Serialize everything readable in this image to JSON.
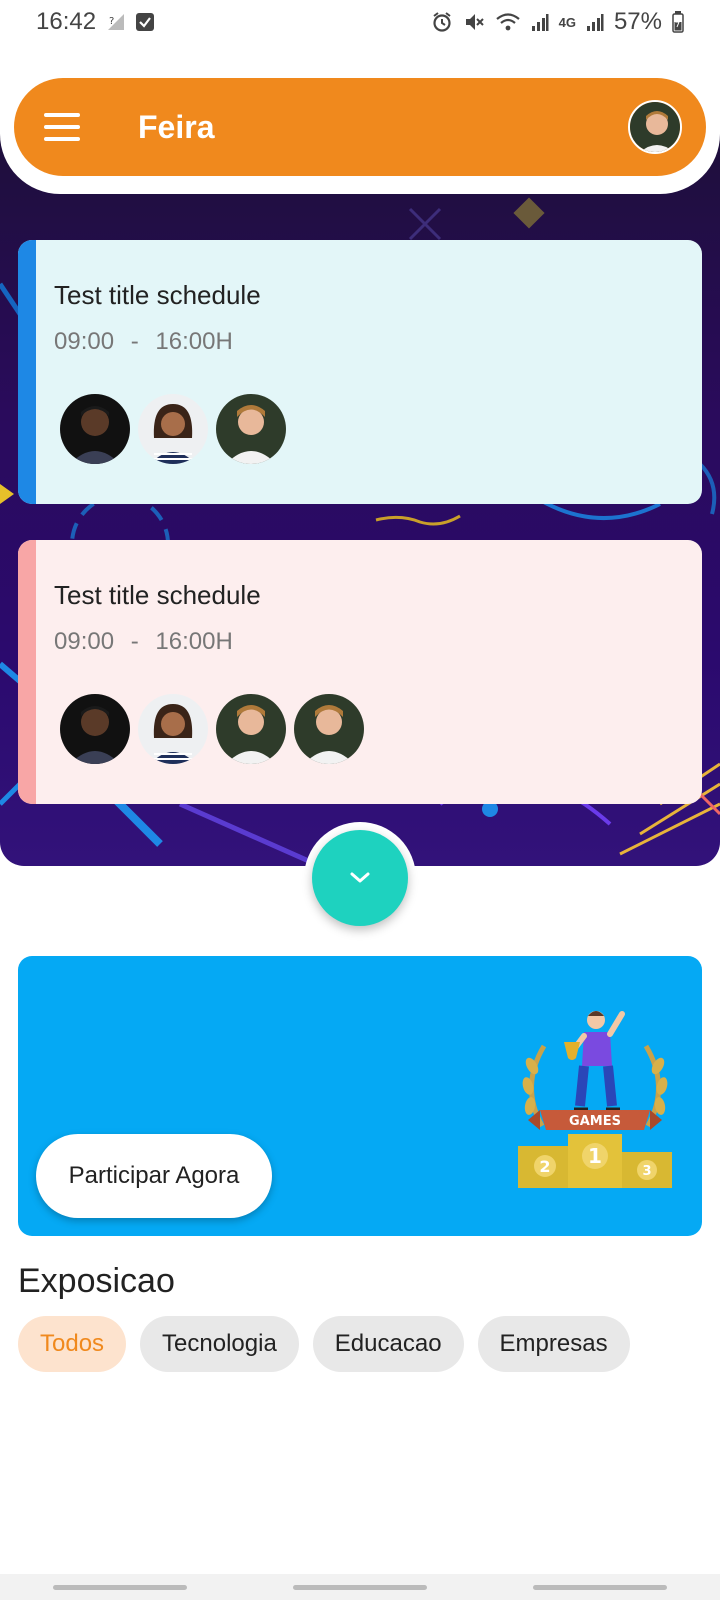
{
  "status_bar": {
    "time": "16:42",
    "battery": "57%",
    "network": "4G",
    "icons": [
      "no-signal-icon",
      "checkbox-icon",
      "alarm-icon",
      "mute-icon",
      "wifi-icon",
      "signal-icon",
      "battery-icon"
    ]
  },
  "app_bar": {
    "title": "Feira",
    "menu_icon": "hamburger-menu-icon",
    "avatar": "user-avatar"
  },
  "schedules": [
    {
      "title": "Test title schedule",
      "start": "09:00",
      "sep": "-",
      "end": "16:00H",
      "stripe_color": "#1e88e5",
      "bg_color": "#e3f6f8",
      "participants": 3
    },
    {
      "title": "Test title schedule",
      "start": "09:00",
      "sep": "-",
      "end": "16:00H",
      "stripe_color": "#f8a6a6",
      "bg_color": "#fdeeee",
      "participants": 4
    }
  ],
  "fab": {
    "icon": "chevron-down-icon",
    "color": "#1ed2bf"
  },
  "promo": {
    "button_label": "Participar Agora",
    "graphic_label": "GAMES",
    "podium": [
      "2",
      "1",
      "3"
    ],
    "color": "#05a9f4"
  },
  "section": {
    "title": "Exposicao",
    "chips": [
      {
        "label": "Todos",
        "active": true
      },
      {
        "label": "Tecnologia",
        "active": false
      },
      {
        "label": "Educacao",
        "active": false
      },
      {
        "label": "Empresas",
        "active": false
      }
    ]
  },
  "colors": {
    "accent": "#f0891d",
    "fab": "#1ed2bf",
    "promo": "#05a9f4"
  }
}
